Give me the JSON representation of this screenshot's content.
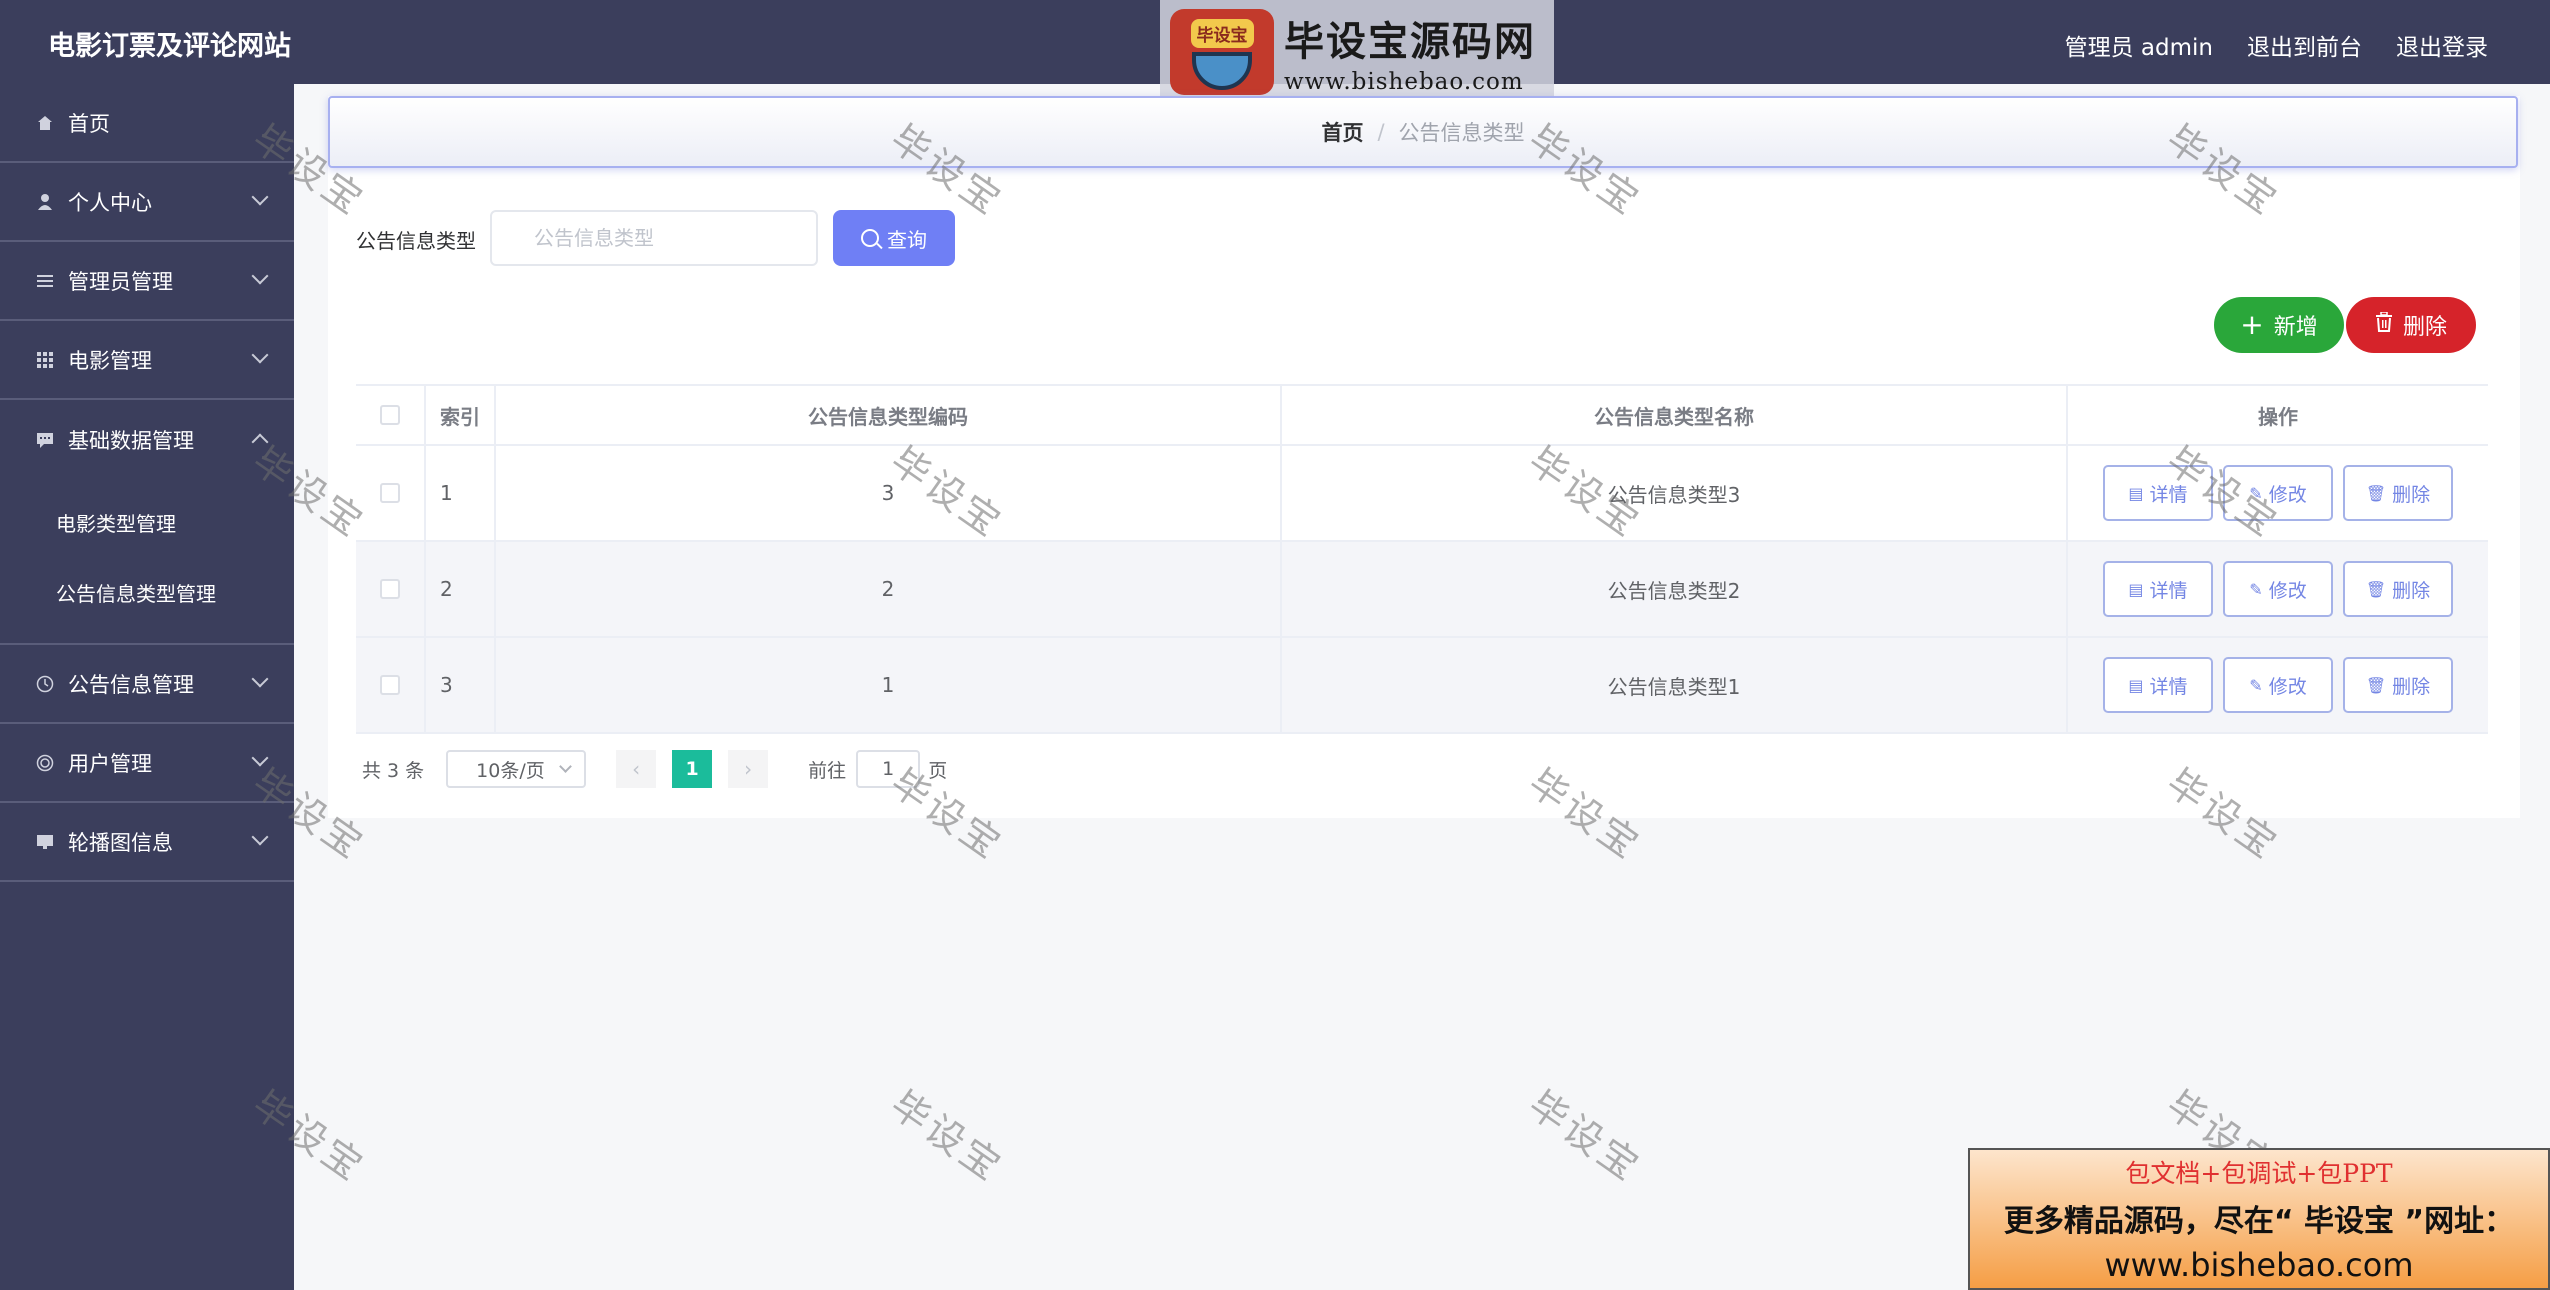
{
  "header": {
    "app_title": "电影订票及评论网站",
    "user_label": "管理员 admin",
    "back_to_front": "退出到前台",
    "logout": "退出登录"
  },
  "logo": {
    "badge": "毕设宝",
    "name": "毕设宝源码网",
    "url": "www.bishebao.com"
  },
  "sidebar": {
    "items": [
      {
        "label": "首页",
        "icon": "home-icon"
      },
      {
        "label": "个人中心",
        "icon": "user-icon"
      },
      {
        "label": "管理员管理",
        "icon": "list-icon"
      },
      {
        "label": "电影管理",
        "icon": "grid-icon"
      },
      {
        "label": "基础数据管理",
        "icon": "chat-icon"
      },
      {
        "label": "公告信息管理",
        "icon": "clock-icon"
      },
      {
        "label": "用户管理",
        "icon": "ring-icon"
      },
      {
        "label": "轮播图信息",
        "icon": "monitor-icon"
      }
    ],
    "subitems": [
      {
        "label": "电影类型管理"
      },
      {
        "label": "公告信息类型管理"
      }
    ]
  },
  "breadcrumb": {
    "home": "首页",
    "separator": "/",
    "current": "公告信息类型"
  },
  "search": {
    "label": "公告信息类型",
    "placeholder": "公告信息类型",
    "button": "查询"
  },
  "actions": {
    "add": "新增",
    "delete": "删除"
  },
  "table": {
    "headers": {
      "index": "索引",
      "code": "公告信息类型编码",
      "name": "公告信息类型名称",
      "ops": "操作"
    },
    "rows": [
      {
        "index": "1",
        "code": "3",
        "name": "公告信息类型3"
      },
      {
        "index": "2",
        "code": "2",
        "name": "公告信息类型2"
      },
      {
        "index": "3",
        "code": "1",
        "name": "公告信息类型1"
      }
    ],
    "row_ops": {
      "detail": "详情",
      "edit": "修改",
      "delete": "删除"
    }
  },
  "pagination": {
    "total": "共 3 条",
    "page_size": "10条/页",
    "current_page": "1",
    "goto_label": "前往",
    "goto_value": "1",
    "page_suffix": "页"
  },
  "watermark": "毕设宝",
  "promo": {
    "line1": "包文档+包调试+包PPT",
    "line2": "更多精品源码，尽在“ 毕设宝 ”网址：",
    "line3": "www.bishebao.com"
  },
  "colors": {
    "sidebar_bg": "#3b3e5c",
    "primary": "#6f7ff5",
    "success": "#2aa73a",
    "danger": "#d6232a",
    "page_active": "#1bbc9b"
  }
}
